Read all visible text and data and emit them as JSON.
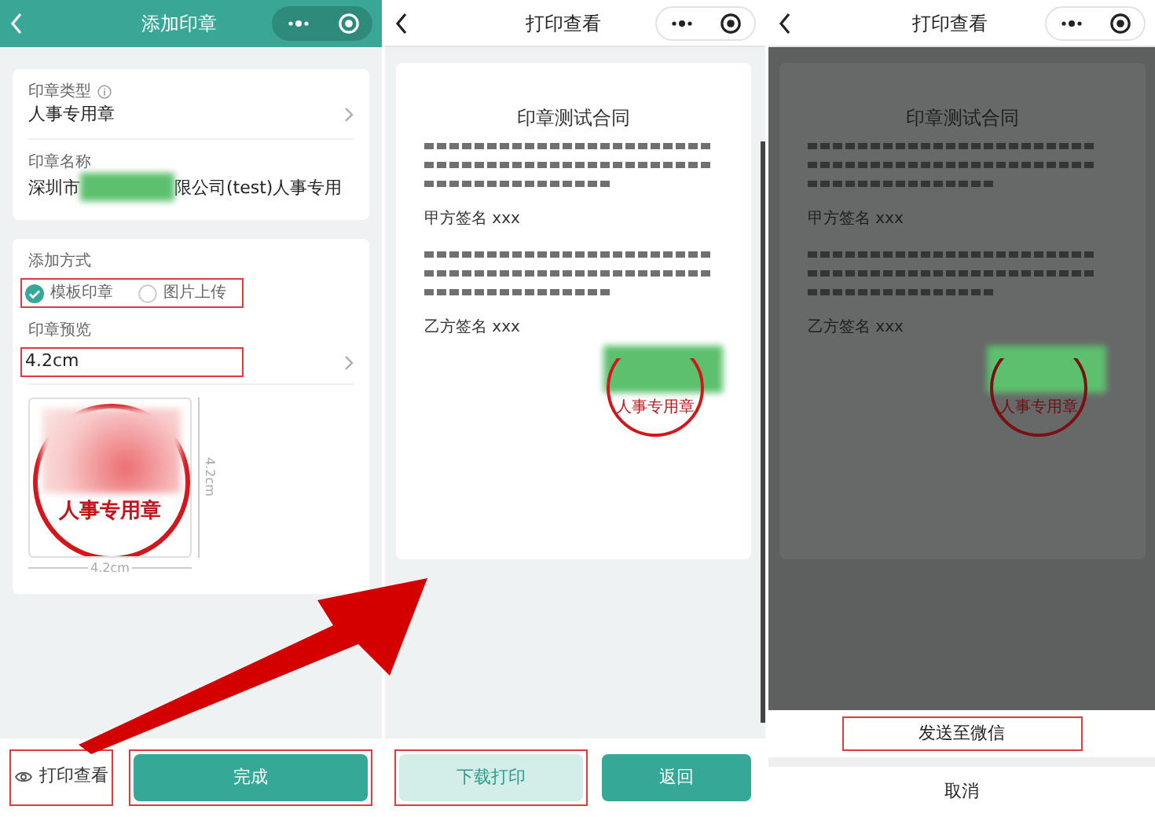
{
  "add_seal_screen": {
    "header": {
      "title": "添加印章"
    },
    "seal_type": {
      "label": "印章类型",
      "value": "人事专用章"
    },
    "seal_name": {
      "label": "印章名称",
      "value_start": "深圳市",
      "value_end": "限公司(test)人事专用"
    },
    "add_method": {
      "label": "添加方式",
      "highlighted": true,
      "options": [
        {
          "label": "模板印章",
          "selected": true
        },
        {
          "label": "图片上传",
          "selected": false
        }
      ]
    },
    "seal_preview": {
      "label": "印章预览",
      "size": "4.2cm",
      "highlighted": true,
      "stamp_text": "人事专用章",
      "height_label": "4.2cm",
      "width_label": "4.2cm"
    },
    "footer": {
      "preview_link": {
        "label": "打印查看",
        "highlighted": true
      },
      "done_button": {
        "label": "完成",
        "highlighted": true
      }
    }
  },
  "print_preview_screen": {
    "header": {
      "title": "打印查看"
    },
    "document": {
      "title": "印章测试合同",
      "party_a": "甲方签名 xxx",
      "party_b": "乙方签名 xxx",
      "stamp_text": "人事专用章"
    },
    "buttons": [
      {
        "label": "下载打印",
        "kind": "secondary",
        "highlighted": true
      },
      {
        "label": "返回",
        "kind": "primary",
        "highlighted": false
      }
    ]
  },
  "share_sheet_screen": {
    "header": {
      "title": "打印查看"
    },
    "document": {
      "title": "印章测试合同",
      "party_a": "甲方签名 xxx",
      "party_b": "乙方签名 xxx",
      "stamp_text": "人事专用章"
    },
    "actions": [
      {
        "label": "发送至微信",
        "highlighted": true
      },
      {
        "label": "取消",
        "highlighted": false
      }
    ]
  }
}
